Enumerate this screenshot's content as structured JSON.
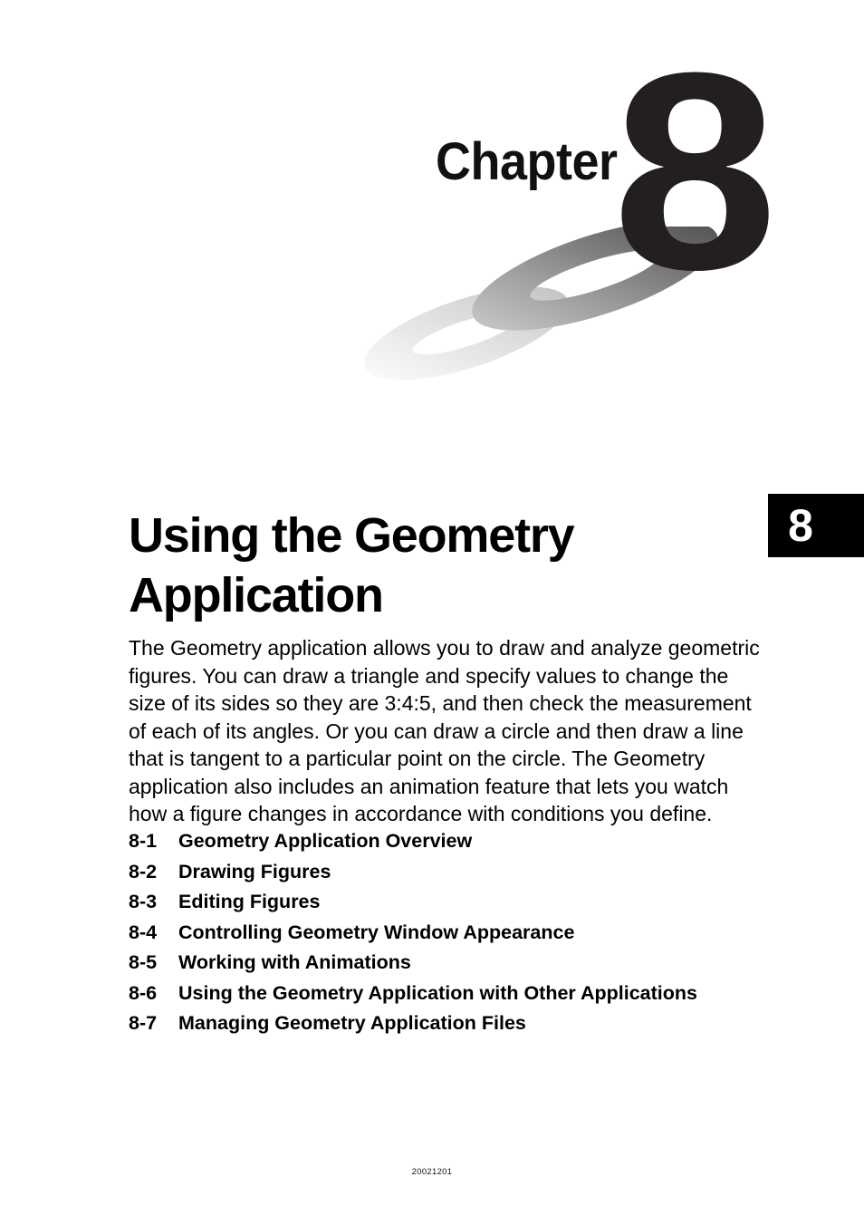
{
  "masthead": {
    "chapter_word": "Chapter",
    "chapter_number": "8"
  },
  "title": {
    "line1": "Using the Geometry",
    "line2": "Application",
    "full": "Using the Geometry Application"
  },
  "chapter_tab": {
    "number": "8"
  },
  "intro": {
    "paragraph": "The Geometry application allows you to draw and analyze geometric figures. You can draw a triangle and specify values to change the size of its sides so they are 3:4:5, and then check the measurement of each of its angles. Or you can draw a circle and then draw a line that is tangent to a particular point on the circle. The Geometry application also includes an animation feature that lets you watch how a figure changes in accordance with conditions you define."
  },
  "sections": [
    {
      "number": "8-1",
      "label": "Geometry Application Overview"
    },
    {
      "number": "8-2",
      "label": "Drawing Figures"
    },
    {
      "number": "8-3",
      "label": "Editing Figures"
    },
    {
      "number": "8-4",
      "label": "Controlling Geometry Window Appearance"
    },
    {
      "number": "8-5",
      "label": "Working with Animations"
    },
    {
      "number": "8-6",
      "label": "Using the Geometry Application with Other Applications"
    },
    {
      "number": "8-7",
      "label": "Managing Geometry Application Files"
    }
  ],
  "footer": {
    "code": "20021201"
  },
  "colors": {
    "page_background": "#ffffff",
    "text": "#000000",
    "chapter_number_fill": "#231f20",
    "tab_background": "#000000",
    "tab_number": "#ffffff",
    "shadow_dark": "#5a5a5a",
    "shadow_light": "#f2f2f2"
  }
}
